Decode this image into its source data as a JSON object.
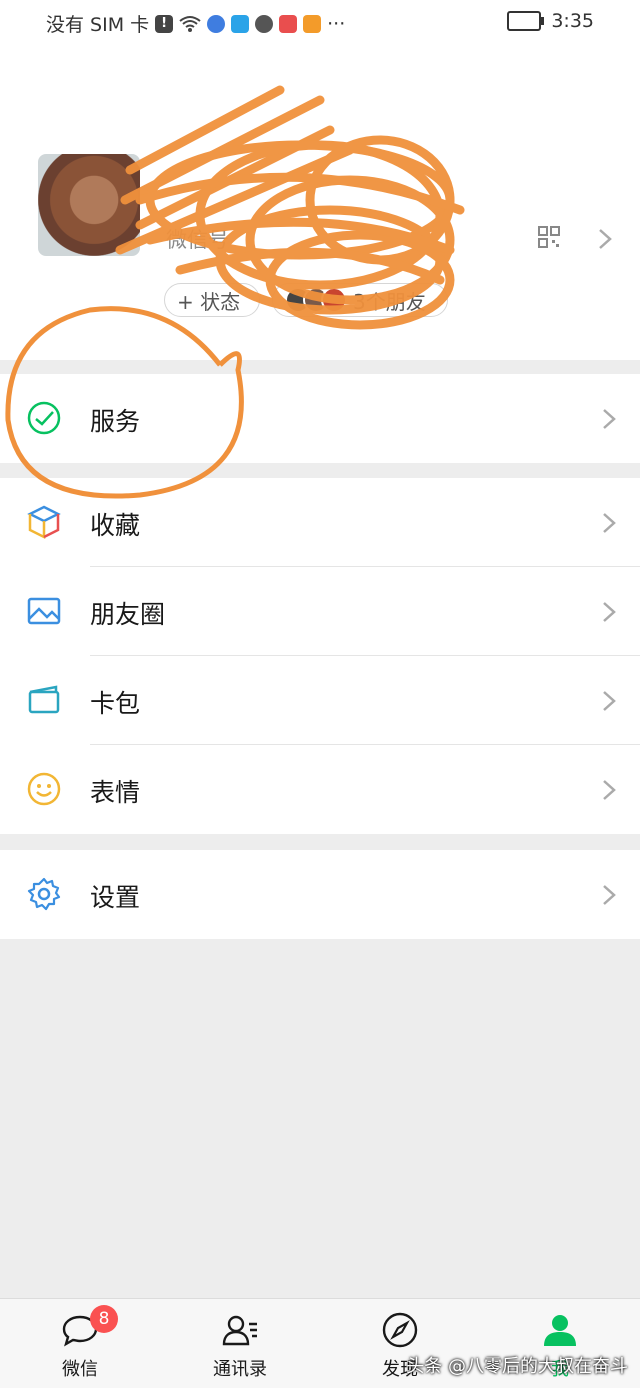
{
  "status_bar": {
    "carrier": "没有 SIM 卡",
    "time": "3:35"
  },
  "profile": {
    "nickname": "",
    "wechat_id": "微信号",
    "status_button": "+ 状态",
    "friends_label": "3个朋友"
  },
  "menu": {
    "services": "服务",
    "favorites": "收藏",
    "moments": "朋友圈",
    "cards": "卡包",
    "stickers": "表情",
    "settings": "设置"
  },
  "tabbar": {
    "chats": "微信",
    "chats_badge": "8",
    "contacts": "通讯录",
    "discover": "发现",
    "me": "我"
  },
  "watermark": "头条 @八零后的大叔在奋斗",
  "colors": {
    "accent_green": "#07c160",
    "badge_red": "#fa5151",
    "scribble_orange": "#f0913c",
    "background": "#ededed"
  }
}
